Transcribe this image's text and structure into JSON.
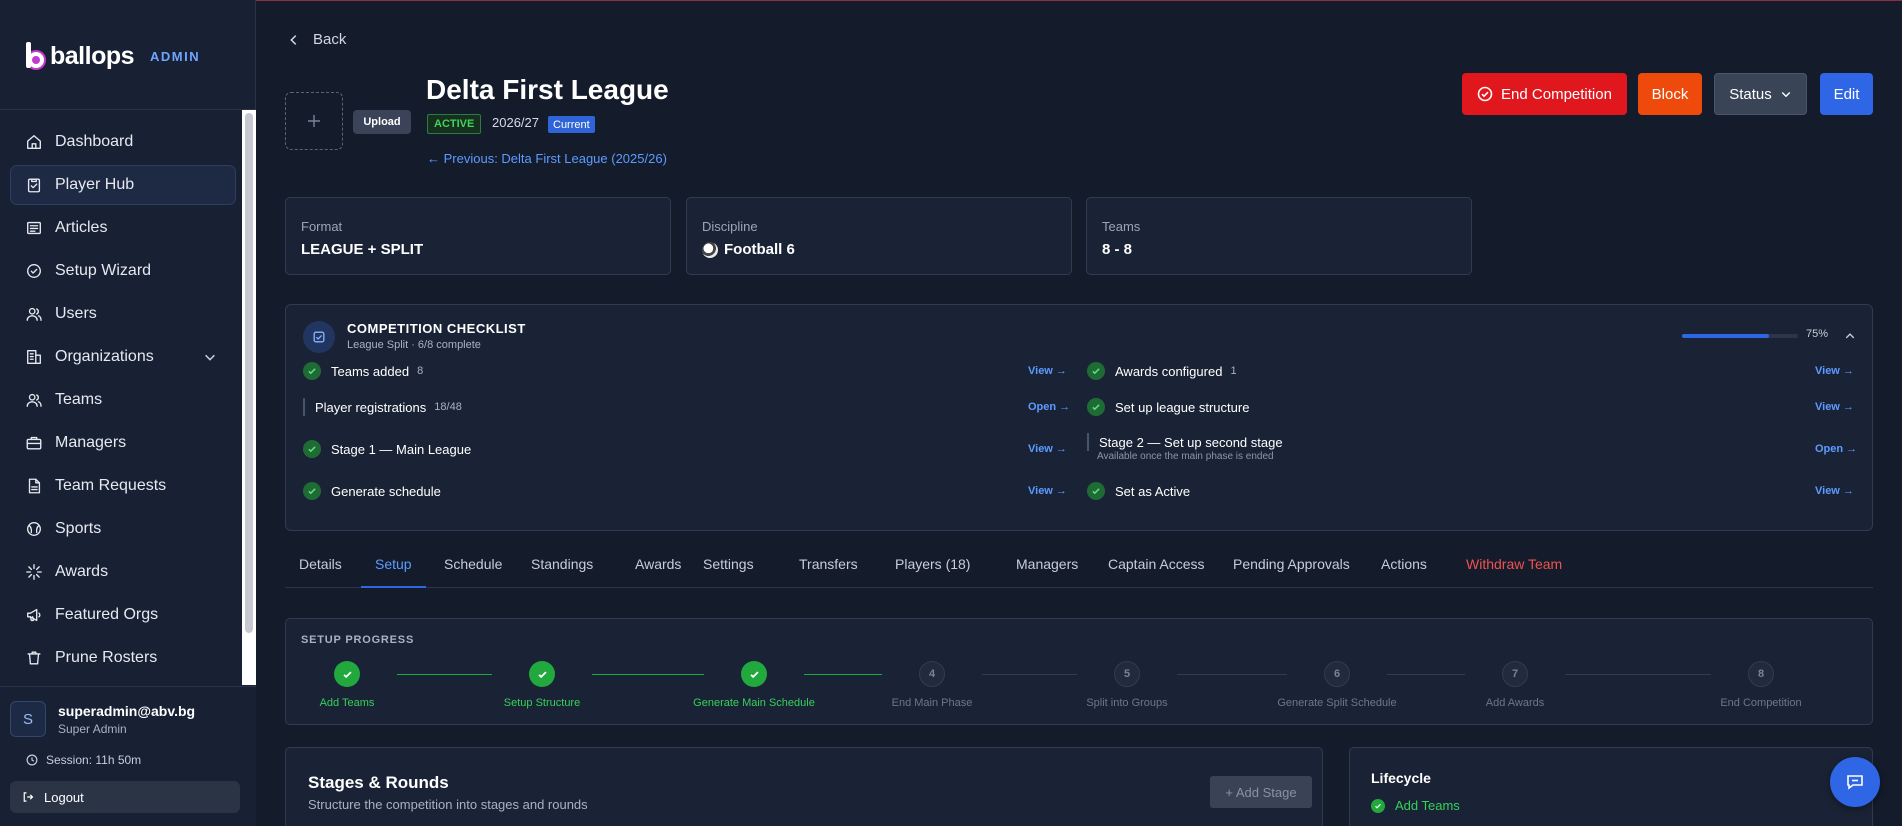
{
  "brand": {
    "name": "ballops",
    "tag": "ADMIN"
  },
  "sidebar": {
    "items": [
      {
        "label": "Dashboard",
        "icon": "home-icon"
      },
      {
        "label": "Player Hub",
        "icon": "clipboard-icon",
        "active": true
      },
      {
        "label": "Articles",
        "icon": "newspaper-icon"
      },
      {
        "label": "Setup Wizard",
        "icon": "check-circle-icon"
      },
      {
        "label": "Users",
        "icon": "users-icon"
      },
      {
        "label": "Organizations",
        "icon": "building-icon",
        "expandable": true
      },
      {
        "label": "Teams",
        "icon": "users-icon"
      },
      {
        "label": "Managers",
        "icon": "briefcase-icon"
      },
      {
        "label": "Team Requests",
        "icon": "document-icon"
      },
      {
        "label": "Sports",
        "icon": "ball-icon"
      },
      {
        "label": "Awards",
        "icon": "sparkle-icon"
      },
      {
        "label": "Featured Orgs",
        "icon": "megaphone-icon"
      },
      {
        "label": "Prune Rosters",
        "icon": "trash-icon"
      }
    ]
  },
  "user": {
    "initial": "S",
    "email": "superadmin@abv.bg",
    "role": "Super Admin",
    "session": "Session: 11h 50m",
    "logout": "Logout"
  },
  "header": {
    "back": "Back",
    "upload": "Upload",
    "title": "Delta First League",
    "status": "ACTIVE",
    "season": "2026/27",
    "current": "Current",
    "previous": "← Previous: Delta First League (2025/26)",
    "actions": {
      "end": "End Competition",
      "block": "Block",
      "status": "Status",
      "edit": "Edit"
    }
  },
  "stats": [
    {
      "label": "Format",
      "value": "LEAGUE + SPLIT"
    },
    {
      "label": "Discipline",
      "value": "Football 6"
    },
    {
      "label": "Teams",
      "value": "8 - 8"
    }
  ],
  "checklist": {
    "title": "COMPETITION CHECKLIST",
    "subtitle": "League Split · 6/8 complete",
    "progress_fraction": 0.75,
    "percent": "75%",
    "left": [
      {
        "label": "Teams added",
        "count": "8",
        "done": true,
        "link": "View →"
      },
      {
        "label": "Player registrations",
        "count": "18/48",
        "done": false,
        "link": "Open →"
      },
      {
        "label": "Stage 1 — Main League",
        "count": "",
        "done": true,
        "link": "View →"
      },
      {
        "label": "Generate schedule",
        "count": "",
        "done": true,
        "link": "View →"
      }
    ],
    "right": [
      {
        "label": "Awards configured",
        "count": "1",
        "done": true,
        "link": "View →"
      },
      {
        "label": "Set up league structure",
        "count": "",
        "done": true,
        "link": "View →"
      },
      {
        "label": "Stage 2 — Set up second stage",
        "count": "",
        "done": false,
        "link": "Open →",
        "note": "Available once the main phase is ended"
      },
      {
        "label": "Set as Active",
        "count": "",
        "done": true,
        "link": "View →"
      }
    ]
  },
  "tabs": [
    {
      "label": "Details"
    },
    {
      "label": "Setup",
      "active": true
    },
    {
      "label": "Schedule"
    },
    {
      "label": "Standings"
    },
    {
      "label": "Awards"
    },
    {
      "label": "Settings"
    },
    {
      "label": "Transfers"
    },
    {
      "label": "Players (18)"
    },
    {
      "label": "Managers"
    },
    {
      "label": "Captain Access"
    },
    {
      "label": "Pending Approvals"
    },
    {
      "label": "Actions"
    },
    {
      "label": "Withdraw Team",
      "danger": true
    }
  ],
  "setup_progress": {
    "title": "SETUP PROGRESS",
    "steps": [
      {
        "label": "Add Teams",
        "number": "1",
        "done": true
      },
      {
        "label": "Setup Structure",
        "number": "2",
        "done": true
      },
      {
        "label": "Generate Main Schedule",
        "number": "3",
        "done": true
      },
      {
        "label": "End Main Phase",
        "number": "4",
        "done": false
      },
      {
        "label": "Split into Groups",
        "number": "5",
        "done": false
      },
      {
        "label": "Generate Split Schedule",
        "number": "6",
        "done": false
      },
      {
        "label": "Add Awards",
        "number": "7",
        "done": false
      },
      {
        "label": "End Competition",
        "number": "8",
        "done": false
      }
    ]
  },
  "stages": {
    "title": "Stages & Rounds",
    "subtitle": "Structure the competition into stages and rounds",
    "add": "+ Add Stage"
  },
  "lifecycle": {
    "title": "Lifecycle",
    "items": [
      "Add Teams"
    ]
  },
  "colors": {
    "accent": "#2f66e6",
    "success": "#22a93d",
    "danger": "#e0171d",
    "warning": "#ed4a0c"
  }
}
